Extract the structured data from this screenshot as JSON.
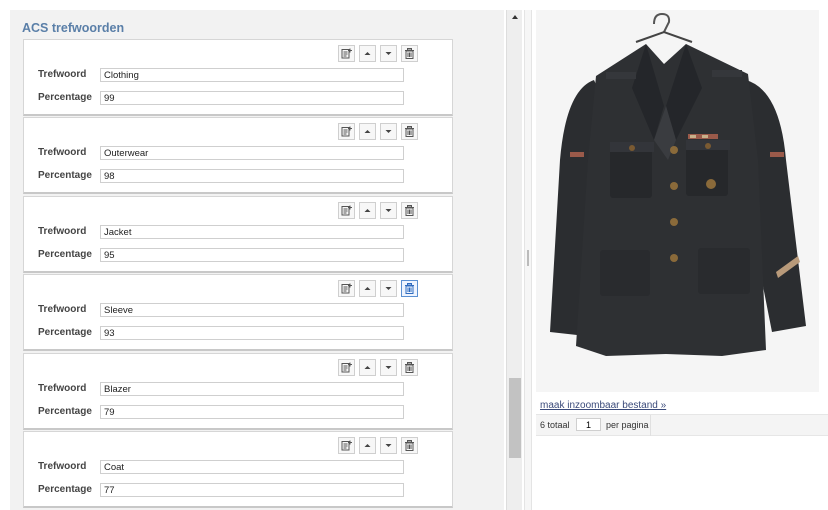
{
  "section": {
    "title": "ACS trefwoorden"
  },
  "labels": {
    "keyword": "Trefwoord",
    "percentage": "Percentage"
  },
  "icons": {
    "add": "add-note-icon",
    "up": "arrow-up-icon",
    "down": "arrow-down-icon",
    "delete": "trash-icon"
  },
  "entries": [
    {
      "keyword": "Clothing",
      "percentage": "99"
    },
    {
      "keyword": "Outerwear",
      "percentage": "98"
    },
    {
      "keyword": "Jacket",
      "percentage": "95"
    },
    {
      "keyword": "Sleeve",
      "percentage": "93"
    },
    {
      "keyword": "Blazer",
      "percentage": "79"
    },
    {
      "keyword": "Coat",
      "percentage": "77"
    }
  ],
  "viewer": {
    "zoom_link": "maak inzoombaar bestand »",
    "pager": {
      "total": "6 totaal",
      "page": "1",
      "per_page": "per pagina"
    }
  },
  "colors": {
    "title": "#5a7fa8",
    "jacket": "#2e3033",
    "link": "#3a4a7a",
    "active_button": "#5b8fd1"
  }
}
